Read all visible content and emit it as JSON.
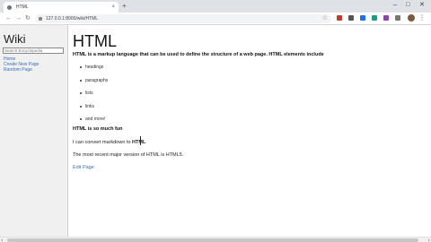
{
  "browser": {
    "tab_title": "HTML",
    "tab_close": "×",
    "new_tab": "+",
    "win_min": "–",
    "win_max": "□",
    "win_close": "✕",
    "back": "←",
    "forward": "→",
    "reload": "↻",
    "url": "127.0.0.1:8000/wiki/HTML",
    "bookmark": "☆",
    "menu": "⋮",
    "extension_colors": [
      "#c0392b",
      "#555555",
      "#1a73e8",
      "#16a085",
      "#8e44ad",
      "#777777"
    ]
  },
  "sidebar": {
    "title": "Wiki",
    "search_placeholder": "Search Encyclopedia",
    "links": [
      "Home",
      "Create New Page",
      "Random Page"
    ]
  },
  "page": {
    "title": "HTML",
    "intro": "HTML is a markup language that can be used to define the structure of a web page. HTML elements include",
    "elements": [
      "headings",
      "paragraphs",
      "lists",
      "links",
      "and more!"
    ],
    "fun": "HTML is so much fun",
    "convert_prefix": "I can convert markdown to ",
    "convert_bold": "HTML",
    "version": "The most recent major version of HTML is HTML5.",
    "edit_link": "Edit Page"
  },
  "scrollbar": {
    "left_arrow": "◂",
    "right_arrow": "▸"
  }
}
